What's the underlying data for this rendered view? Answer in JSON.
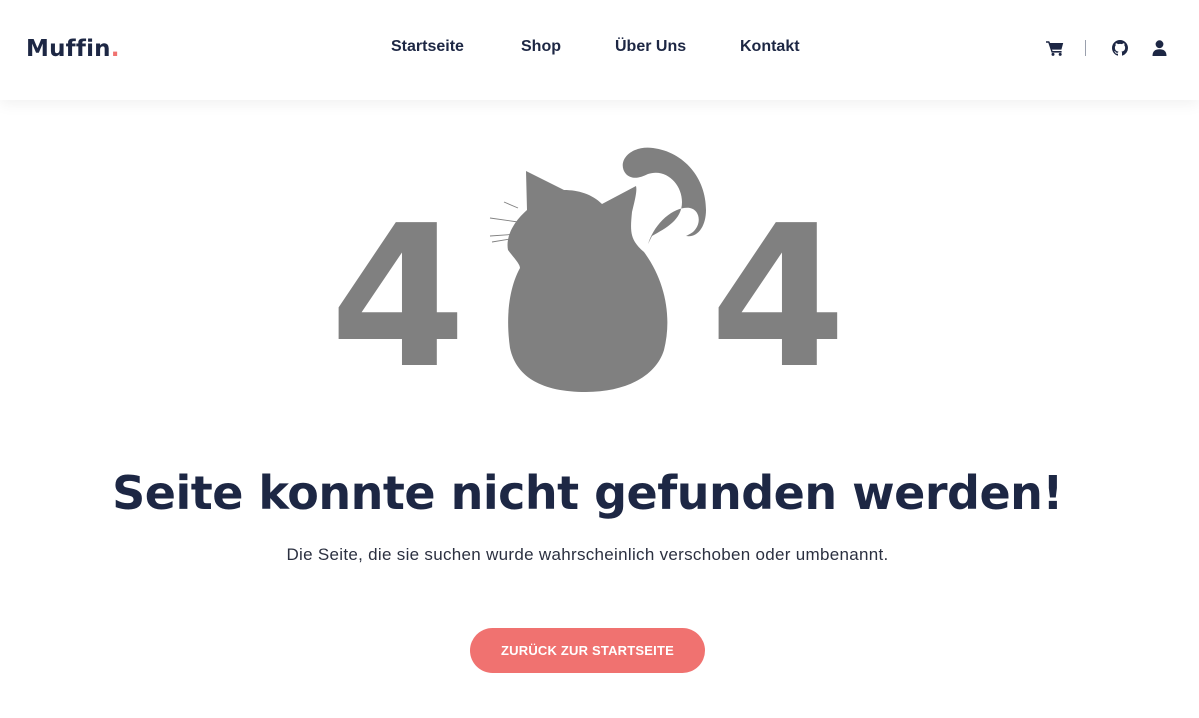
{
  "brand": {
    "name": "Muffin",
    "dot": ".",
    "accent": "#f07270",
    "primary": "#1d2744"
  },
  "nav": {
    "items": [
      {
        "label": "Startseite"
      },
      {
        "label": "Shop"
      },
      {
        "label": "Über Uns"
      },
      {
        "label": "Kontakt"
      }
    ]
  },
  "header_icons": [
    "cart-icon",
    "github-icon",
    "user-icon"
  ],
  "error": {
    "digit_left": "4",
    "digit_right": "4",
    "art_color": "#808080",
    "headline": "Seite konnte nicht gefunden werden!",
    "message": "Die Seite, die sie suchen wurde wahrscheinlich verschoben oder umbenannt.",
    "button_label": "ZURÜCK ZUR STARTSEITE"
  }
}
